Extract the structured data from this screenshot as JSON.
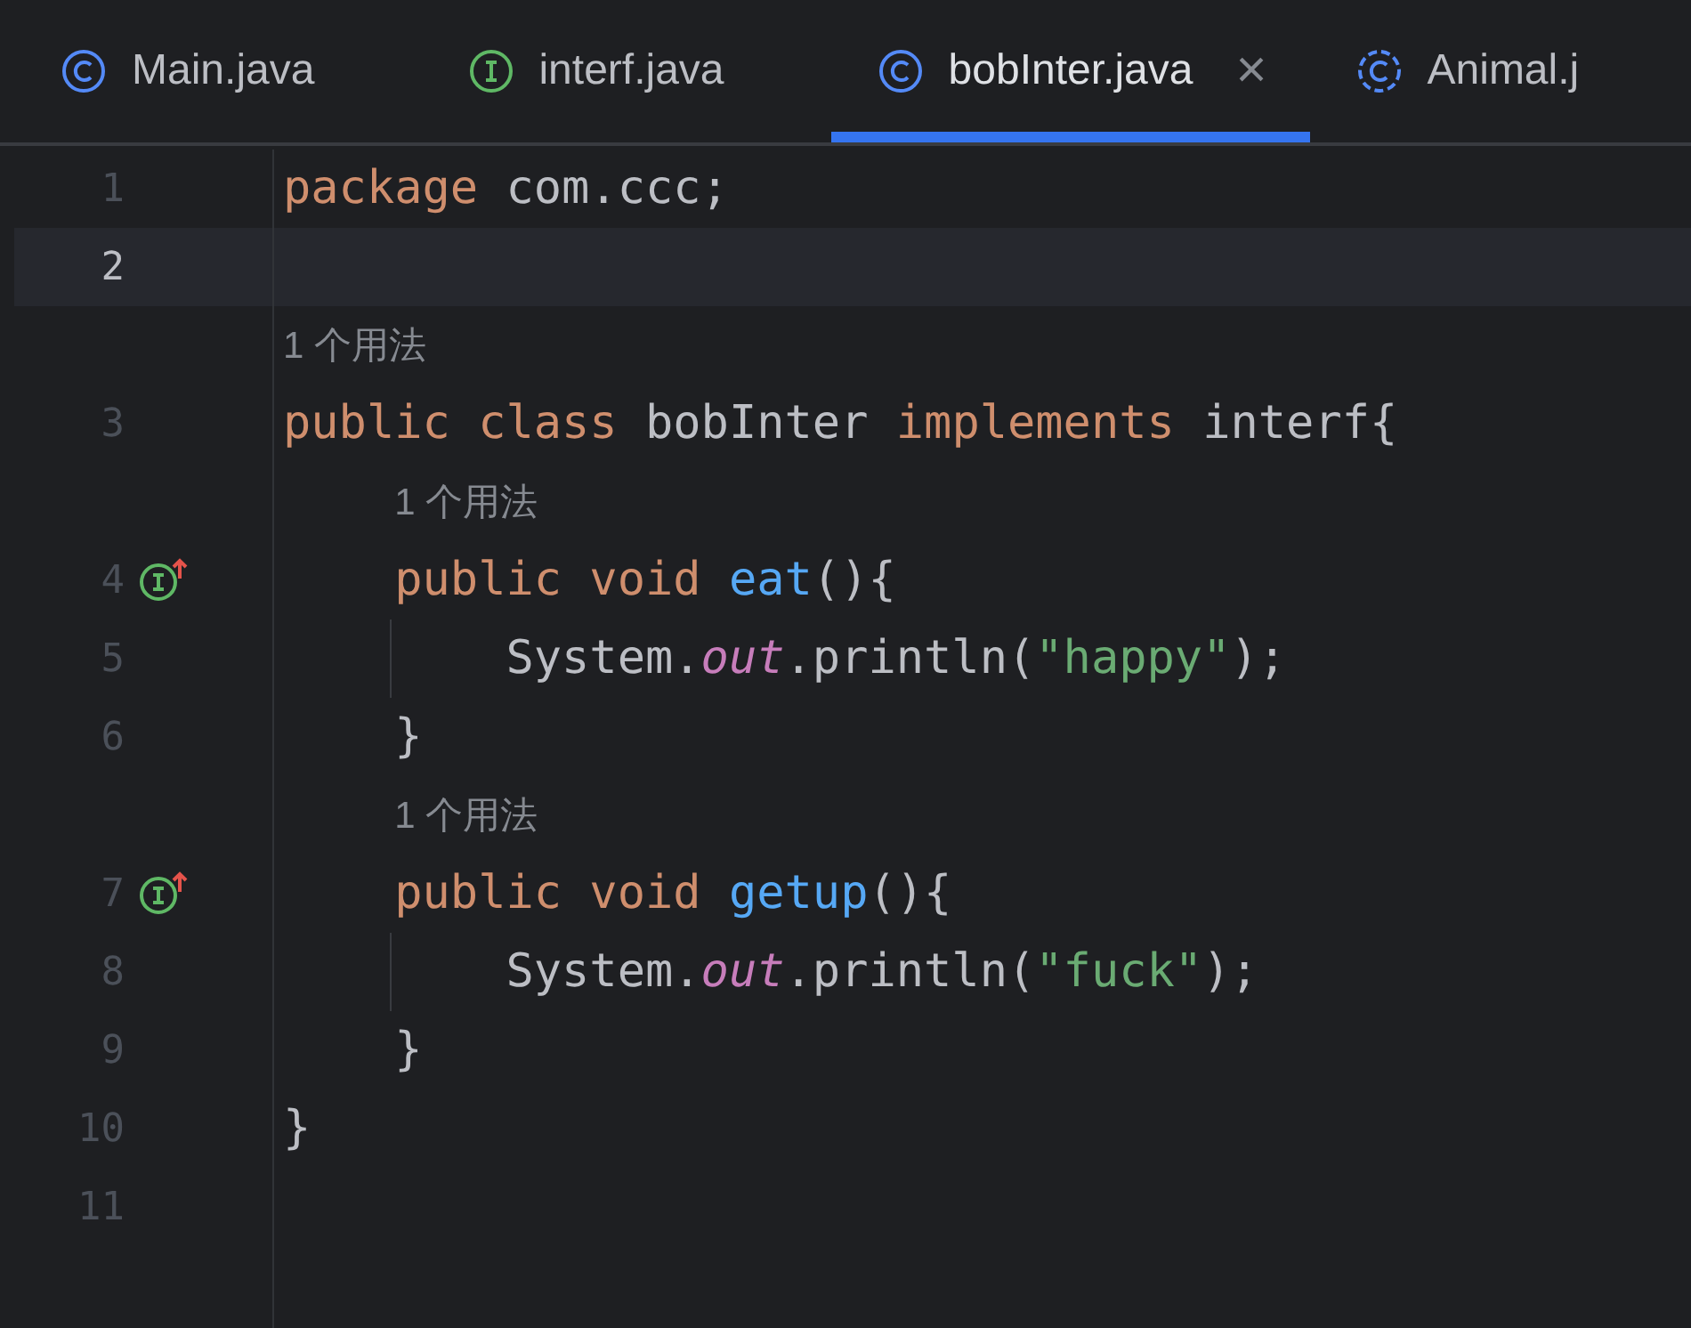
{
  "tabs": [
    {
      "label": "Main.java",
      "kind": "class",
      "selected": false
    },
    {
      "label": "interf.java",
      "kind": "interface",
      "selected": false
    },
    {
      "label": "bobInter.java",
      "kind": "class",
      "selected": true,
      "close": "×"
    },
    {
      "label": "Animal.j",
      "kind": "abstract",
      "selected": false
    }
  ],
  "lines": [
    {
      "kind": "code",
      "number": "1",
      "current": false,
      "implemented": false,
      "tokens": [
        {
          "kind": "keyword",
          "text": "package "
        },
        {
          "kind": "plain",
          "text": "com.ccc;"
        }
      ]
    },
    {
      "kind": "code",
      "number": "2",
      "current": true,
      "implemented": false
    },
    {
      "kind": "hint",
      "text": "1 个用法"
    },
    {
      "kind": "code",
      "number": "3",
      "current": false,
      "implemented": false,
      "tokens": [
        {
          "kind": "keyword",
          "text": "public class "
        },
        {
          "kind": "plain",
          "text": "bobInter "
        },
        {
          "kind": "keyword",
          "text": "implements "
        },
        {
          "kind": "plain",
          "text": "interf{"
        }
      ],
      "children": [
        {
          "kind": "hint",
          "text": "1 个用法"
        },
        {
          "kind": "code",
          "number": "4",
          "current": false,
          "implemented": true,
          "tokens": [
            {
              "kind": "keyword",
              "text": "public void "
            },
            {
              "kind": "method",
              "text": "eat"
            },
            {
              "kind": "plain",
              "text": "(){"
            }
          ],
          "children": [
            {
              "kind": "code",
              "number": "5",
              "current": false,
              "implemented": false,
              "tokens": [
                {
                  "kind": "plain",
                  "text": "System."
                },
                {
                  "kind": "static",
                  "text": "out"
                },
                {
                  "kind": "plain",
                  "text": ".println("
                },
                {
                  "kind": "string",
                  "text": "\"happy\""
                },
                {
                  "kind": "plain",
                  "text": ");"
                }
              ]
            }
          ]
        },
        {
          "kind": "code",
          "number": "6",
          "current": false,
          "implemented": false,
          "tokens": [
            {
              "kind": "plain",
              "text": "}"
            }
          ]
        },
        {
          "kind": "hint",
          "text": "1 个用法"
        },
        {
          "kind": "code",
          "number": "7",
          "current": false,
          "implemented": true,
          "tokens": [
            {
              "kind": "keyword",
              "text": "public void "
            },
            {
              "kind": "method",
              "text": "getup"
            },
            {
              "kind": "plain",
              "text": "(){"
            }
          ],
          "children": [
            {
              "kind": "code",
              "number": "8",
              "current": false,
              "implemented": false,
              "tokens": [
                {
                  "kind": "plain",
                  "text": "System."
                },
                {
                  "kind": "static",
                  "text": "out"
                },
                {
                  "kind": "plain",
                  "text": ".println("
                },
                {
                  "kind": "string",
                  "text": "\"fuck\""
                },
                {
                  "kind": "plain",
                  "text": ");"
                }
              ]
            }
          ]
        },
        {
          "kind": "code",
          "number": "9",
          "current": false,
          "implemented": false,
          "tokens": [
            {
              "kind": "plain",
              "text": "}"
            }
          ]
        }
      ]
    },
    {
      "kind": "code",
      "number": "10",
      "current": false,
      "implemented": false,
      "tokens": [
        {
          "kind": "plain",
          "text": "}"
        }
      ]
    },
    {
      "kind": "code",
      "number": "11",
      "current": false,
      "implemented": false
    }
  ]
}
